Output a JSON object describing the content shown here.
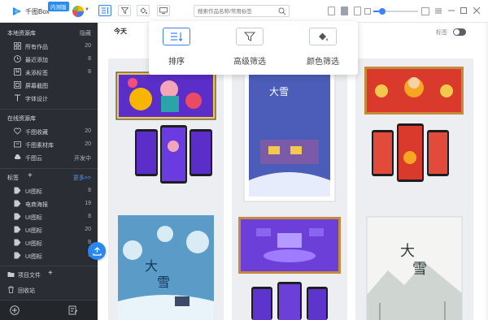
{
  "app": {
    "title": "千图Box",
    "edition_badge": "内测版"
  },
  "search": {
    "placeholder": "搜索作品名称/常用标签"
  },
  "sidebar": {
    "local_section": {
      "title": "本地资源库",
      "action": "隐藏"
    },
    "local_items": [
      {
        "label": "所有作品",
        "count": "20",
        "icon": "grid-icon"
      },
      {
        "label": "最近添加",
        "count": "8",
        "icon": "clock-icon"
      },
      {
        "label": "未添标签",
        "count": "8",
        "icon": "bookmark-icon"
      },
      {
        "label": "屏幕截图",
        "count": "",
        "icon": "screenshot-icon"
      },
      {
        "label": "字体设计",
        "count": "",
        "icon": "font-icon"
      }
    ],
    "online_section": {
      "title": "在线资源库"
    },
    "online_items": [
      {
        "label": "千图收藏",
        "count": "20",
        "icon": "heart-icon"
      },
      {
        "label": "千图素材库",
        "count": "20",
        "icon": "library-icon"
      },
      {
        "label": "千图云",
        "count": "开发中",
        "icon": "cloud-icon"
      }
    ],
    "tags_section": {
      "title": "标签",
      "more": "更多>>"
    },
    "tag_items": [
      {
        "label": "UI图标",
        "count": "8"
      },
      {
        "label": "电商海报",
        "count": "19"
      },
      {
        "label": "UI图标",
        "count": "8"
      },
      {
        "label": "UI图标",
        "count": "20"
      },
      {
        "label": "UI图标",
        "count": "8"
      },
      {
        "label": "UI图标",
        "count": "8"
      }
    ],
    "project_files": "项目文件",
    "recycle_bin": "回收站"
  },
  "main": {
    "group_title": "今天",
    "tag_toggle_label": "标签",
    "tag_toggle_on": false
  },
  "popup": {
    "items": [
      {
        "label": "排序",
        "icon": "sort-icon",
        "active": true
      },
      {
        "label": "高级筛选",
        "icon": "filter-icon",
        "active": false
      },
      {
        "label": "颜色筛选",
        "icon": "paint-bucket-icon",
        "active": false
      }
    ]
  },
  "zoom": {
    "level": 0.2
  },
  "colors": {
    "accent": "#2b87f0",
    "sidebar_bg": "#2a2d33",
    "card_bg": "#eef0f2"
  }
}
